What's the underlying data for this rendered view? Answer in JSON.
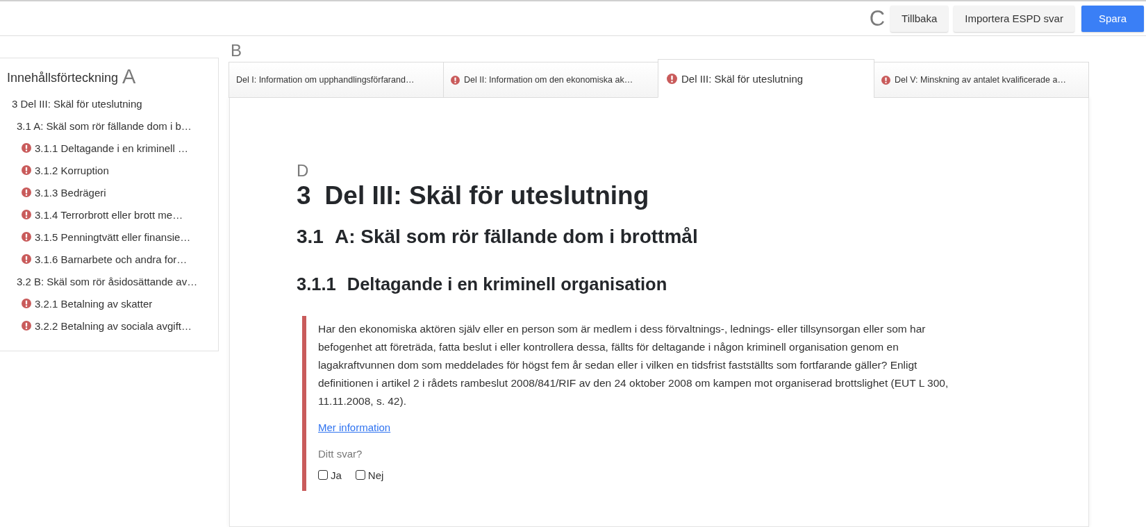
{
  "toolbar": {
    "marker": "C",
    "buttons": [
      {
        "label": "Tillbaka",
        "kind": "secondary"
      },
      {
        "label": "Importera ESPD svar",
        "kind": "secondary"
      },
      {
        "label": "Spara",
        "kind": "primary"
      }
    ]
  },
  "sidebar": {
    "title": "Innehållsförteckning",
    "marker": "A",
    "items": [
      {
        "label": "3 Del III: Skäl för uteslutning",
        "warning": false,
        "children": [
          {
            "label": "3.1 A: Skäl som rör fällande dom i b…",
            "warning": false,
            "children": [
              {
                "label": "3.1.1 Deltagande i en kriminell …",
                "warning": true
              },
              {
                "label": "3.1.2 Korruption",
                "warning": true
              },
              {
                "label": "3.1.3 Bedrägeri",
                "warning": true
              },
              {
                "label": "3.1.4 Terrorbrott eller brott me…",
                "warning": true
              },
              {
                "label": "3.1.5 Penningtvätt eller finansie…",
                "warning": true
              },
              {
                "label": "3.1.6 Barnarbete och andra for…",
                "warning": true
              }
            ]
          },
          {
            "label": "3.2 B: Skäl som rör åsidosättande av…",
            "warning": false,
            "children": [
              {
                "label": "3.2.1 Betalning av skatter",
                "warning": true
              },
              {
                "label": "3.2.2 Betalning av sociala avgift…",
                "warning": true
              }
            ]
          }
        ]
      }
    ]
  },
  "tabs": {
    "marker": "B",
    "items": [
      {
        "label": "Del I: Information om upphandlingsförfarand…",
        "warning": false,
        "selected": false
      },
      {
        "label": "Del II: Information om den ekonomiska ak…",
        "warning": true,
        "selected": false
      },
      {
        "label": "Del III: Skäl för uteslutning",
        "warning": true,
        "selected": true
      },
      {
        "label": "Del V: Minskning av antalet kvalificerade a…",
        "warning": true,
        "selected": false
      }
    ]
  },
  "content": {
    "marker": "D",
    "headings": [
      {
        "kind": "h1",
        "number": "3",
        "title": "Del III: Skäl för uteslutning"
      },
      {
        "kind": "h2",
        "number": "3.1",
        "title": "A: Skäl som rör fällande dom i brottmål"
      },
      {
        "kind": "h3",
        "number": "3.1.1",
        "title": "Deltagande i en kriminell organisation"
      }
    ],
    "question": {
      "invalid": true,
      "text": "Har den ekonomiska aktören själv eller en person som är medlem i dess förvaltnings-, lednings- eller tillsynsorgan eller som har befogenhet att företräda, fatta beslut i eller kontrollera dessa, fällts för deltagande i någon kriminell organisation genom en lagakraftvunnen dom som meddelades för högst fem år sedan eller i vilken en tidsfrist fastställts som fortfarande gäller? Enligt definitionen i artikel 2 i rådets rambeslut 2008/841/RIF av den 24 oktober 2008 om kampen mot organiserad brottslighet (EUT L 300, 11.11.2008, s. 42).",
      "link": "Mer information",
      "answer_label": "Ditt svar?",
      "options": [
        {
          "label": "Ja",
          "checked": false
        },
        {
          "label": "Nej",
          "checked": false
        }
      ]
    }
  }
}
